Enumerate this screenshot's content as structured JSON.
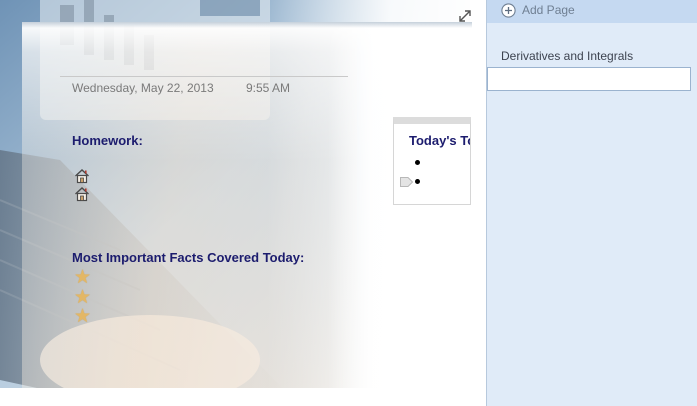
{
  "note": {
    "date": "Wednesday, May 22, 2013",
    "time": "9:55 AM",
    "homework_heading": "Homework:",
    "homework_tags": [
      "home-tag",
      "home-tag"
    ],
    "facts_heading": "Most Important Facts Covered Today:",
    "fact_tags": [
      "star-tag",
      "star-tag",
      "star-tag"
    ],
    "todo": {
      "title": "Today's To Do",
      "items": [
        "",
        ""
      ]
    }
  },
  "pages_pane": {
    "add_page_label": "Add Page",
    "pages": [
      {
        "title": "Derivatives and Integrals"
      }
    ],
    "new_page_value": ""
  },
  "colors": {
    "heading": "#1c1c6e",
    "pane_background": "#e0ebf8",
    "add_page_bar": "#c5d9f1",
    "star": "#e3b765"
  }
}
